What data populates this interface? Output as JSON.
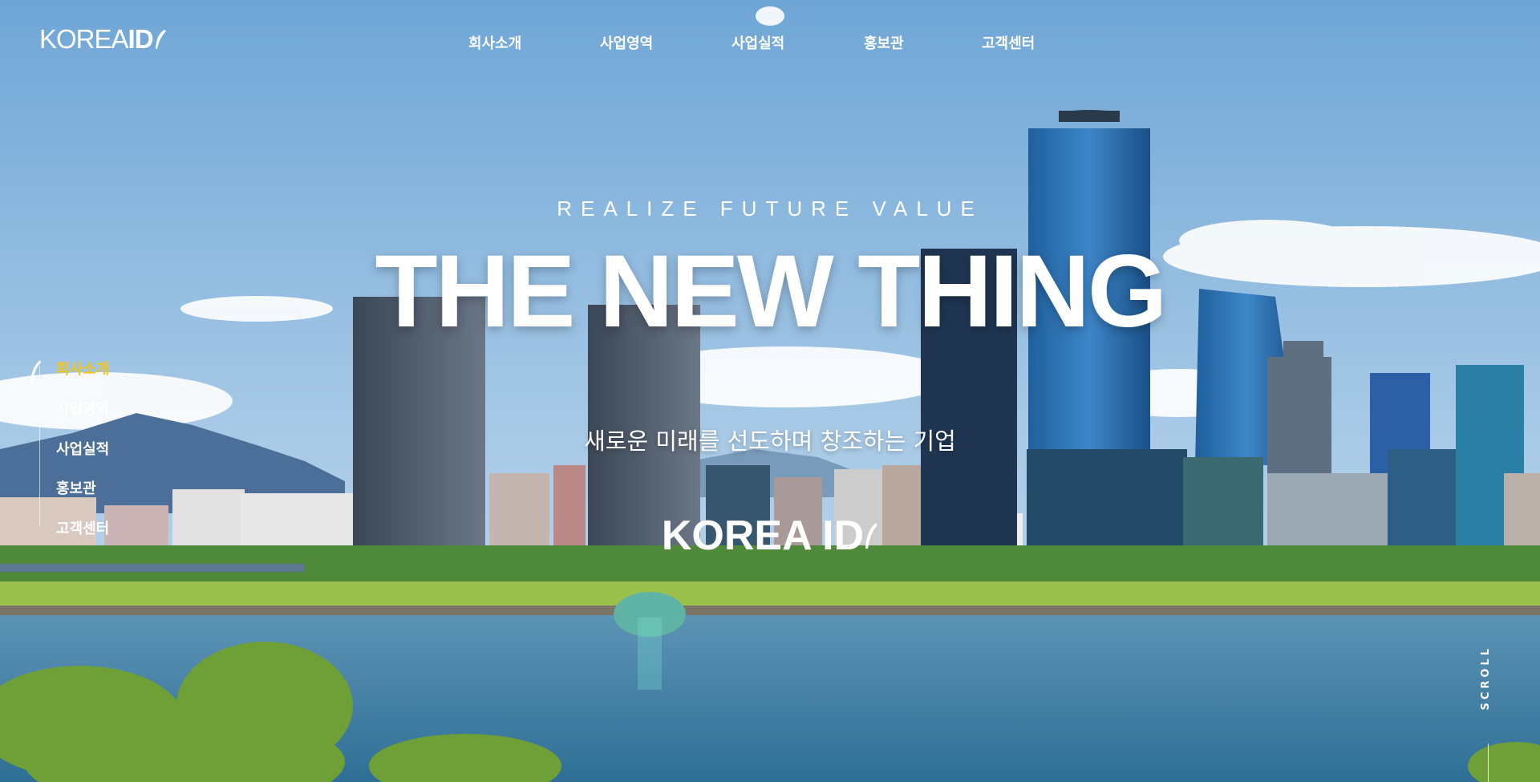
{
  "brand": {
    "logo_text": "KOREA ",
    "logo_id": "ID",
    "logo_icon": "feather-icon"
  },
  "top_nav": {
    "items": [
      "회사소개",
      "사업영역",
      "사업실적",
      "홍보관",
      "고객센터"
    ]
  },
  "hero": {
    "tagline": "REALIZE FUTURE VALUE",
    "headline": "THE NEW THING",
    "subtitle": "새로운 미래를 선도하며 창조하는 기업",
    "brand_text": "KOREA ID"
  },
  "side_nav": {
    "active_index": 0,
    "items": [
      "회사소개",
      "사업영역",
      "사업실적",
      "홍보관",
      "고객센터"
    ]
  },
  "scroll_indicator": {
    "label": "SCROLL"
  },
  "colors": {
    "accent": "#f5c518",
    "text": "#ffffff",
    "sky": "#7fb0d8",
    "water": "#3d7fa6"
  }
}
